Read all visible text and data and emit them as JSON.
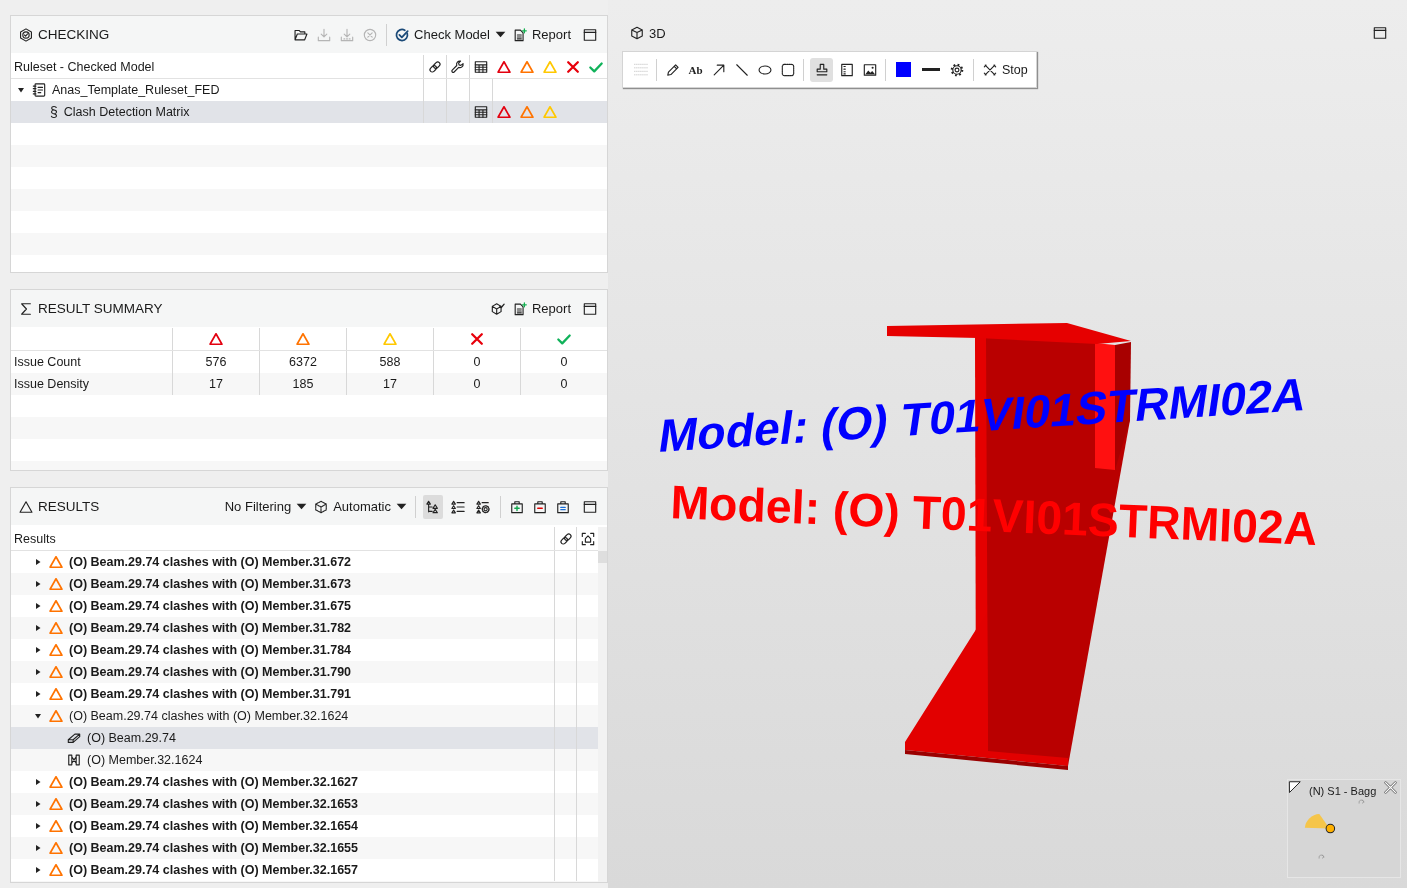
{
  "checking": {
    "title": "CHECKING",
    "tools": [
      {
        "kind": "open",
        "disabled": false
      },
      {
        "kind": "download",
        "disabled": true
      },
      {
        "kind": "download-all",
        "disabled": true
      },
      {
        "kind": "cancel",
        "disabled": true
      }
    ],
    "check_model": "Check Model",
    "report": "Report",
    "tree_header": "Ruleset - Checked Model",
    "columns": [
      {
        "kind": "link"
      },
      {
        "kind": "wrench"
      },
      {
        "kind": "matrix"
      },
      {
        "kind": "critical"
      },
      {
        "kind": "major"
      },
      {
        "kind": "minor"
      },
      {
        "kind": "failed"
      },
      {
        "kind": "passed"
      }
    ],
    "tree": [
      {
        "label": "Anas_Template_Ruleset_FED",
        "kind": "ruleset",
        "expanded": true,
        "selected": false,
        "children": [
          {
            "label": "Clash Detection Matrix",
            "kind": "rule",
            "symbol": "§",
            "selected": true,
            "marks": [
              {
                "kind": "matrix"
              },
              {
                "kind": "critical"
              },
              {
                "kind": "major"
              },
              {
                "kind": "minor"
              }
            ]
          }
        ]
      }
    ]
  },
  "summary": {
    "title": "RESULT SUMMARY",
    "report": "Report",
    "columns": [
      {
        "kind": "critical"
      },
      {
        "kind": "major"
      },
      {
        "kind": "minor"
      },
      {
        "kind": "failed"
      },
      {
        "kind": "passed"
      }
    ],
    "rows": [
      {
        "label": "Issue Count",
        "values": [
          "576",
          "6372",
          "588",
          "0",
          "0"
        ]
      },
      {
        "label": "Issue Density",
        "values": [
          "17",
          "185",
          "17",
          "0",
          "0"
        ]
      }
    ]
  },
  "results": {
    "title": "RESULTS",
    "filter": "No Filtering",
    "mode": "Automatic",
    "views": [
      {
        "kind": "tree",
        "selected": true
      },
      {
        "kind": "list",
        "selected": false
      },
      {
        "kind": "grouped",
        "selected": false
      }
    ],
    "column_label": "Results",
    "icon_columns": [
      {
        "kind": "link"
      },
      {
        "kind": "focus"
      }
    ],
    "items": [
      {
        "label": "(O) Beam.29.74 clashes with (O) Member.31.672",
        "kind": "major",
        "viewed": false,
        "expanded": false,
        "selected": false
      },
      {
        "label": "(O) Beam.29.74 clashes with (O) Member.31.673",
        "kind": "major",
        "viewed": false,
        "expanded": false,
        "selected": false
      },
      {
        "label": "(O) Beam.29.74 clashes with (O) Member.31.675",
        "kind": "major",
        "viewed": false,
        "expanded": false,
        "selected": false
      },
      {
        "label": "(O) Beam.29.74 clashes with (O) Member.31.782",
        "kind": "major",
        "viewed": false,
        "expanded": false,
        "selected": false
      },
      {
        "label": "(O) Beam.29.74 clashes with (O) Member.31.784",
        "kind": "major",
        "viewed": false,
        "expanded": false,
        "selected": false
      },
      {
        "label": "(O) Beam.29.74 clashes with (O) Member.31.790",
        "kind": "major",
        "viewed": false,
        "expanded": false,
        "selected": false
      },
      {
        "label": "(O) Beam.29.74 clashes with (O) Member.31.791",
        "kind": "major",
        "viewed": false,
        "expanded": false,
        "selected": false
      },
      {
        "label": "(O) Beam.29.74 clashes with (O) Member.32.1624",
        "kind": "major",
        "viewed": true,
        "expanded": true,
        "selected": false,
        "children": [
          {
            "label": "(O) Beam.29.74",
            "kind": "beam",
            "selected": true
          },
          {
            "label": "(O) Member.32.1624",
            "kind": "member",
            "selected": false
          }
        ]
      },
      {
        "label": "(O) Beam.29.74 clashes with (O) Member.32.1627",
        "kind": "major",
        "viewed": false,
        "expanded": false,
        "selected": false
      },
      {
        "label": "(O) Beam.29.74 clashes with (O) Member.32.1653",
        "kind": "major",
        "viewed": false,
        "expanded": false,
        "selected": false
      },
      {
        "label": "(O) Beam.29.74 clashes with (O) Member.32.1654",
        "kind": "major",
        "viewed": false,
        "expanded": false,
        "selected": false
      },
      {
        "label": "(O) Beam.29.74 clashes with (O) Member.32.1655",
        "kind": "major",
        "viewed": false,
        "expanded": false,
        "selected": false
      },
      {
        "label": "(O) Beam.29.74 clashes with (O) Member.32.1657",
        "kind": "major",
        "viewed": false,
        "expanded": false,
        "selected": false
      }
    ]
  },
  "viewport": {
    "title": "3D",
    "tool_groups": [
      [
        {
          "kind": "grid",
          "selected": false
        }
      ],
      [
        {
          "kind": "pencil",
          "selected": false
        },
        {
          "kind": "text",
          "label": "Ab",
          "selected": false
        },
        {
          "kind": "arrow",
          "selected": false
        },
        {
          "kind": "line",
          "selected": false
        },
        {
          "kind": "ellipse",
          "selected": false
        },
        {
          "kind": "region",
          "selected": false
        }
      ],
      [
        {
          "kind": "stamp",
          "selected": true
        },
        {
          "kind": "legend",
          "selected": false
        },
        {
          "kind": "image",
          "selected": false
        }
      ],
      [
        {
          "kind": "color",
          "color": "#0000ff"
        },
        {
          "kind": "thickness"
        },
        {
          "kind": "settings"
        }
      ]
    ],
    "stop": "Stop",
    "labels": [
      {
        "text": "Model: (O) T01VI01STRMI02A",
        "color": "#0000ff"
      },
      {
        "text": "Model: (O) T01VI01STRMI02A",
        "color": "#ff0000"
      }
    ],
    "navigator": {
      "label": "(N) S1 - Bagg"
    }
  }
}
